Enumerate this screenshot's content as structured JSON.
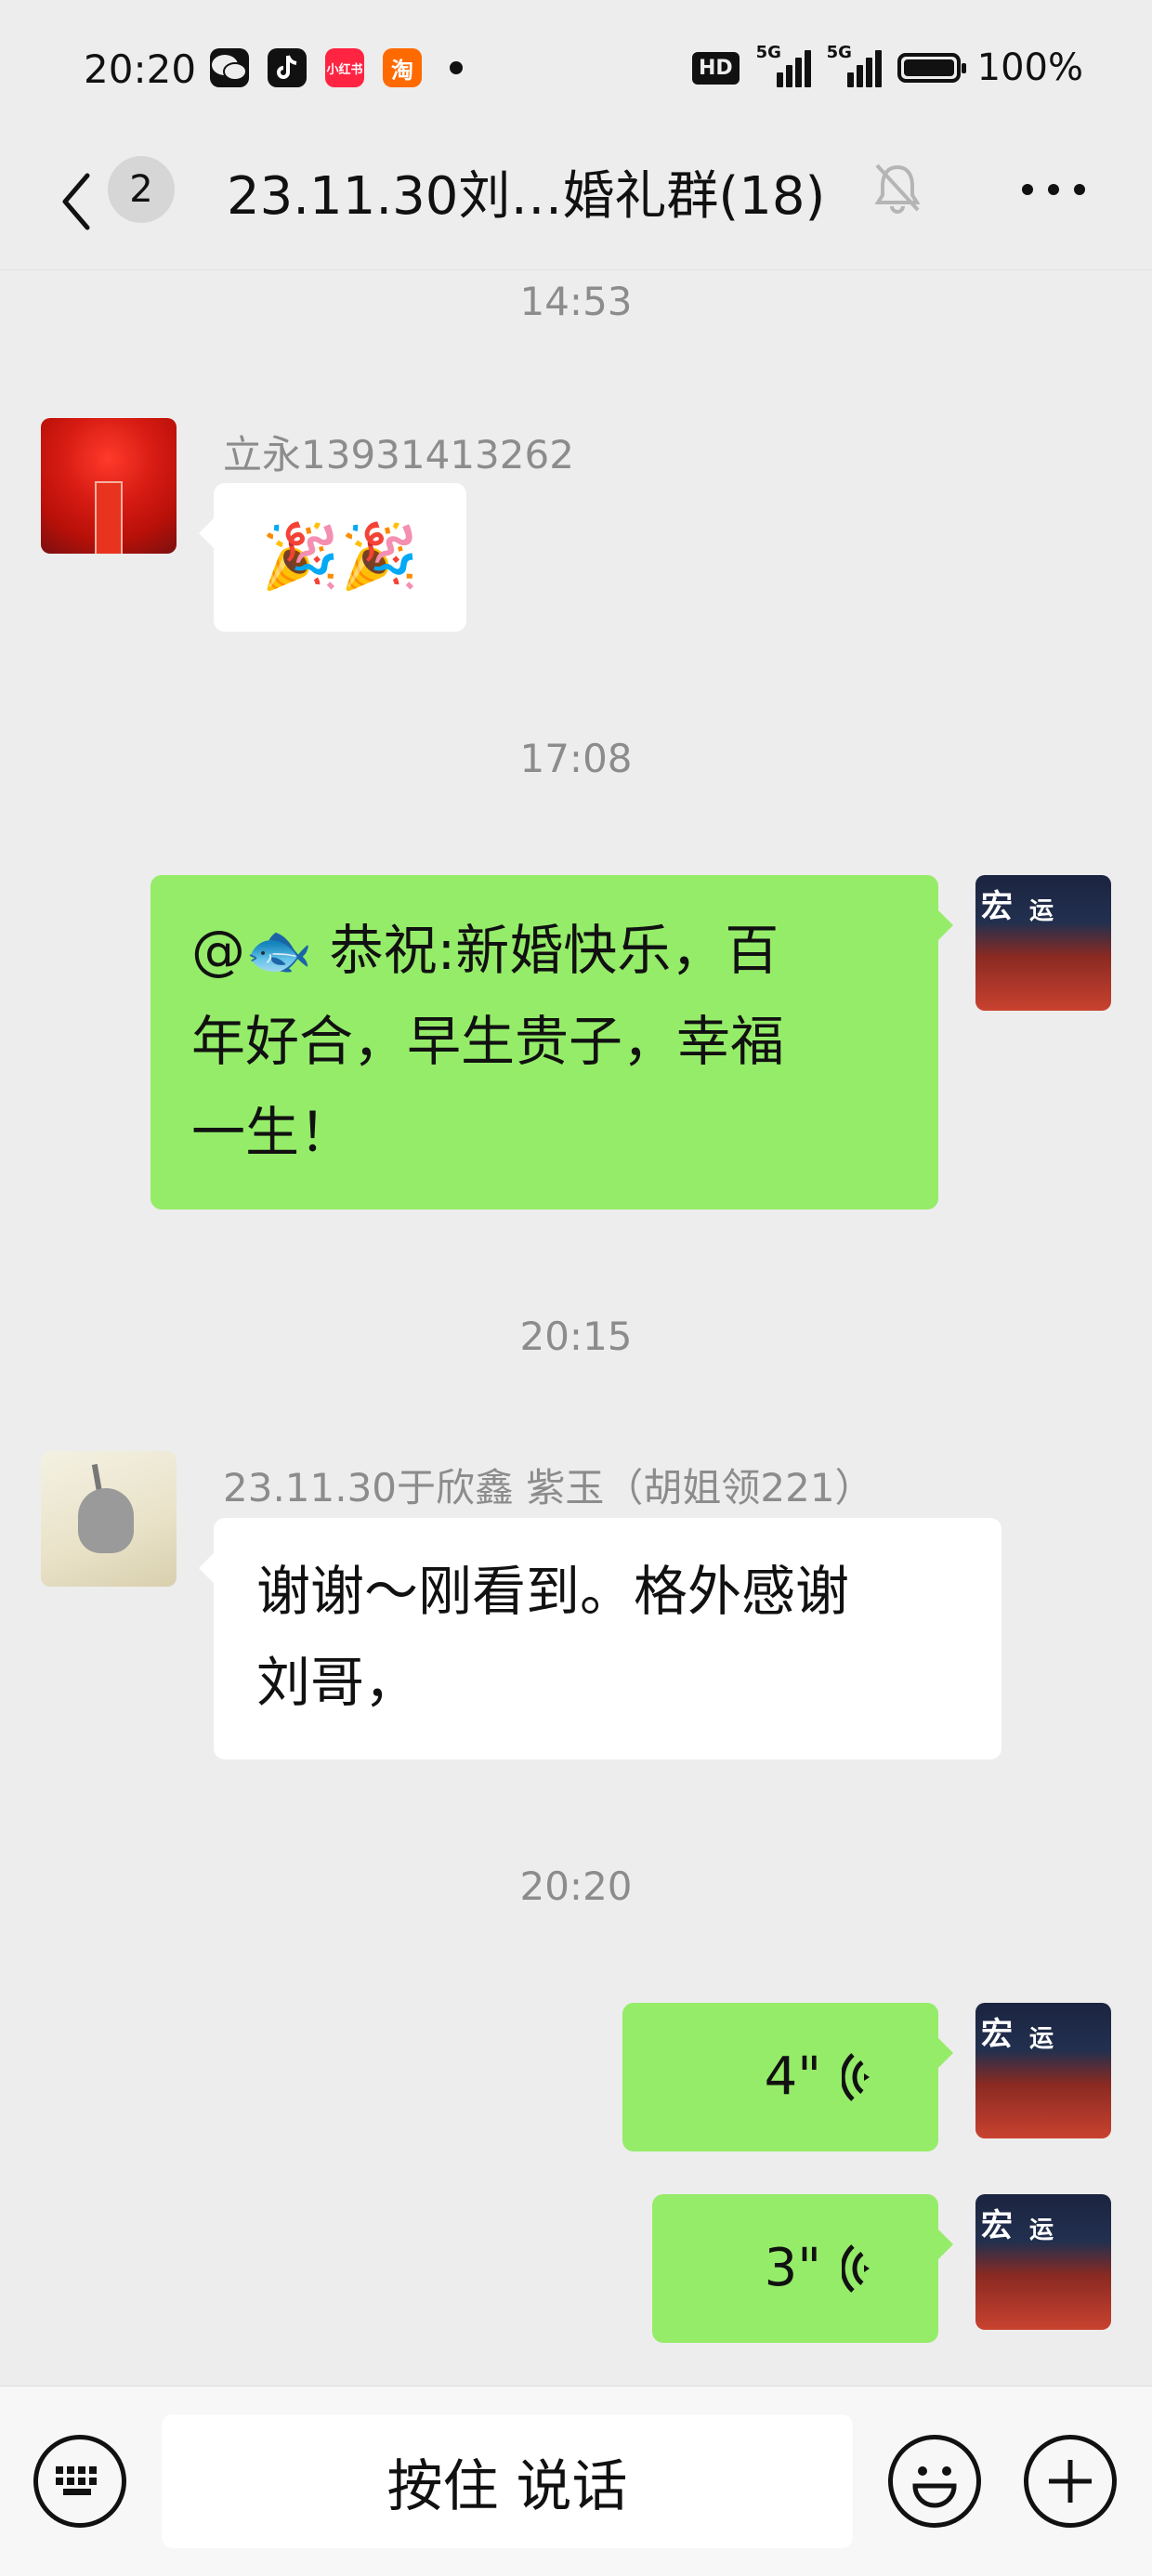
{
  "status_bar": {
    "time": "20:20",
    "apps": [
      {
        "name": "wechat-icon",
        "label": ""
      },
      {
        "name": "douyin-icon",
        "label": ""
      },
      {
        "name": "xiaohongshu-icon",
        "label": "小红书"
      },
      {
        "name": "taobao-icon",
        "label": "淘"
      }
    ],
    "hd_label": "HD",
    "network": "5G",
    "battery": "100%"
  },
  "header": {
    "unread_count": "2",
    "title": "23.11.30刘…婚礼群(18)"
  },
  "messages": [
    {
      "type": "timestamp",
      "text": "14:53"
    },
    {
      "type": "incoming",
      "sender": "立永13931413262",
      "text": "🎉🎉"
    },
    {
      "type": "timestamp",
      "text": "17:08"
    },
    {
      "type": "outgoing",
      "text_line1": "@🐟  恭祝:新婚快乐，百",
      "text_line2": "年好合，早生贵子，幸福",
      "text_line3": "一生！"
    },
    {
      "type": "timestamp",
      "text": "20:15"
    },
    {
      "type": "incoming",
      "sender": "23.11.30于欣鑫 紫玉（胡姐领221）",
      "text_line1": "谢谢～刚看到。格外感谢",
      "text_line2": "刘哥，"
    },
    {
      "type": "timestamp",
      "text": "20:20"
    },
    {
      "type": "voice",
      "duration": "4\""
    },
    {
      "type": "voice",
      "duration": "3\""
    }
  ],
  "input_bar": {
    "hold_to_talk": "按住 说话"
  }
}
